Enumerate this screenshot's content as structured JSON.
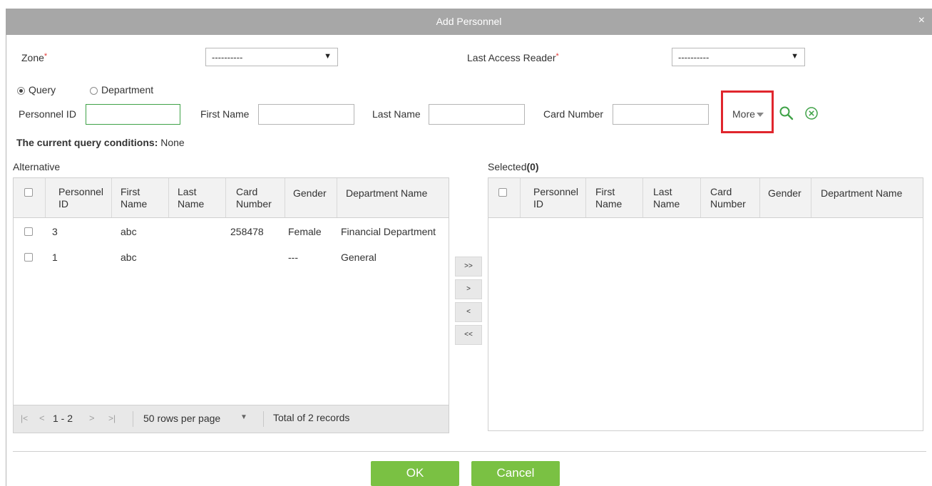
{
  "dialog": {
    "title": "Add Personnel",
    "close_glyph": "×"
  },
  "filters": {
    "zone_label": "Zone",
    "zone_value": "----------",
    "reader_label": "Last Access Reader",
    "reader_value": "----------",
    "required_mark": "*"
  },
  "query_mode": {
    "options": [
      "Query",
      "Department"
    ],
    "selected": "Query"
  },
  "search": {
    "personnel_id_label": "Personnel ID",
    "first_name_label": "First Name",
    "last_name_label": "Last Name",
    "card_number_label": "Card Number",
    "more_label": "More",
    "search_icon": "magnifier-icon",
    "clear_icon": "circle-x-icon"
  },
  "conditions": {
    "label": "The current query conditions:",
    "value": "None"
  },
  "alternative": {
    "title": "Alternative",
    "columns": [
      "Personnel\nID",
      "First\nName",
      "Last\nName",
      "Card\nNumber",
      "Gender",
      "Department Name"
    ],
    "rows": [
      [
        "3",
        "abc",
        "",
        "258478",
        "Female",
        "Financial Department"
      ],
      [
        "1",
        "abc",
        "",
        "",
        "---",
        "General"
      ]
    ],
    "pager": {
      "first": "|<",
      "prev": "<",
      "range": "1 - 2",
      "next": ">",
      "last": ">|",
      "per_page": "50 rows per page",
      "total": "Total of 2 records"
    }
  },
  "transfer": {
    "all_right": ">>",
    "right": ">",
    "left": "<",
    "all_left": "<<"
  },
  "selected": {
    "title": "Selected",
    "count": "(0)",
    "columns": [
      "Personnel\nID",
      "First\nName",
      "Last\nName",
      "Card\nNumber",
      "Gender",
      "Department Name"
    ]
  },
  "actions": {
    "ok": "OK",
    "cancel": "Cancel"
  },
  "colors": {
    "accent_green": "#7ac143",
    "title_bar": "#a7a7a7",
    "highlight_red": "#e0262d"
  }
}
